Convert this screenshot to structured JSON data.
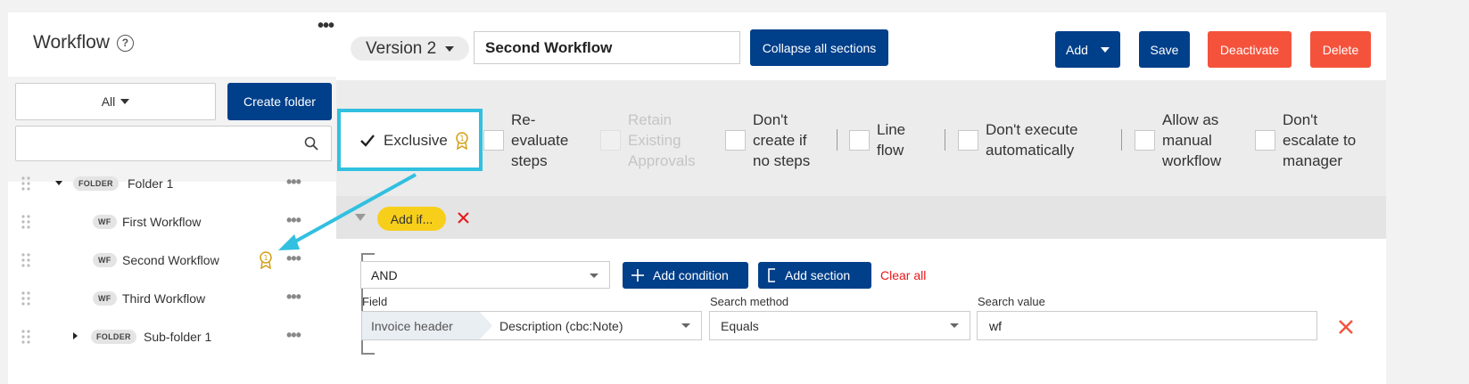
{
  "sidebar": {
    "title": "Workflow",
    "help_icon": "?",
    "filter_select": "All",
    "create_folder_label": "Create folder",
    "search_placeholder": "",
    "tree": [
      {
        "badge": "FOLDER",
        "label": "Folder 1",
        "expanded": true
      },
      {
        "badge": "WF",
        "label": "First Workflow"
      },
      {
        "badge": "WF",
        "label": "Second Workflow",
        "exclusive": true
      },
      {
        "badge": "WF",
        "label": "Third Workflow"
      },
      {
        "badge": "FOLDER",
        "label": "Sub-folder 1",
        "expanded": false
      }
    ],
    "row_more": "•••",
    "menu_more": "•••"
  },
  "header": {
    "version_label": "Version 2",
    "workflow_name": "Second Workflow",
    "collapse_label": "Collapse all sections",
    "add_label": "Add",
    "save_label": "Save",
    "deactivate_label": "Deactivate",
    "delete_label": "Delete"
  },
  "options": {
    "exclusive": {
      "label": "Exclusive",
      "checked": true
    },
    "reevaluate": {
      "label_lines": [
        "Re-",
        "evaluate",
        "steps"
      ],
      "checked": false
    },
    "retain": {
      "label_lines": [
        "Retain",
        "Existing",
        "Approvals"
      ],
      "checked": false,
      "disabled": true
    },
    "dont_create": {
      "label_lines": [
        "Don't",
        "create if",
        "no steps"
      ],
      "checked": false
    },
    "line_flow": {
      "label_lines": [
        "Line",
        "flow"
      ],
      "checked": false
    },
    "dont_execute": {
      "label_lines": [
        "Don't execute",
        "automatically"
      ],
      "checked": false
    },
    "allow_manual": {
      "label_lines": [
        "Allow as",
        "manual",
        "workflow"
      ],
      "checked": false
    },
    "dont_escalate": {
      "label_lines": [
        "Don't",
        "escalate to",
        "manager"
      ],
      "checked": false
    }
  },
  "condition": {
    "add_if_label": "Add if...",
    "operator": "AND",
    "add_condition_label": "Add condition",
    "add_section_label": "Add section",
    "clear_all_label": "Clear all",
    "field_label": "Field",
    "field_prefix": "Invoice header",
    "field_value": "Description (cbc:Note)",
    "method_label": "Search method",
    "method_value": "Equals",
    "search_value_label": "Search value",
    "search_value": "wf"
  },
  "colors": {
    "primary": "#003f8a",
    "danger": "#f5523c",
    "highlight": "#31c0e0",
    "add_if": "#f7cf1a",
    "award": "#d4a017"
  }
}
